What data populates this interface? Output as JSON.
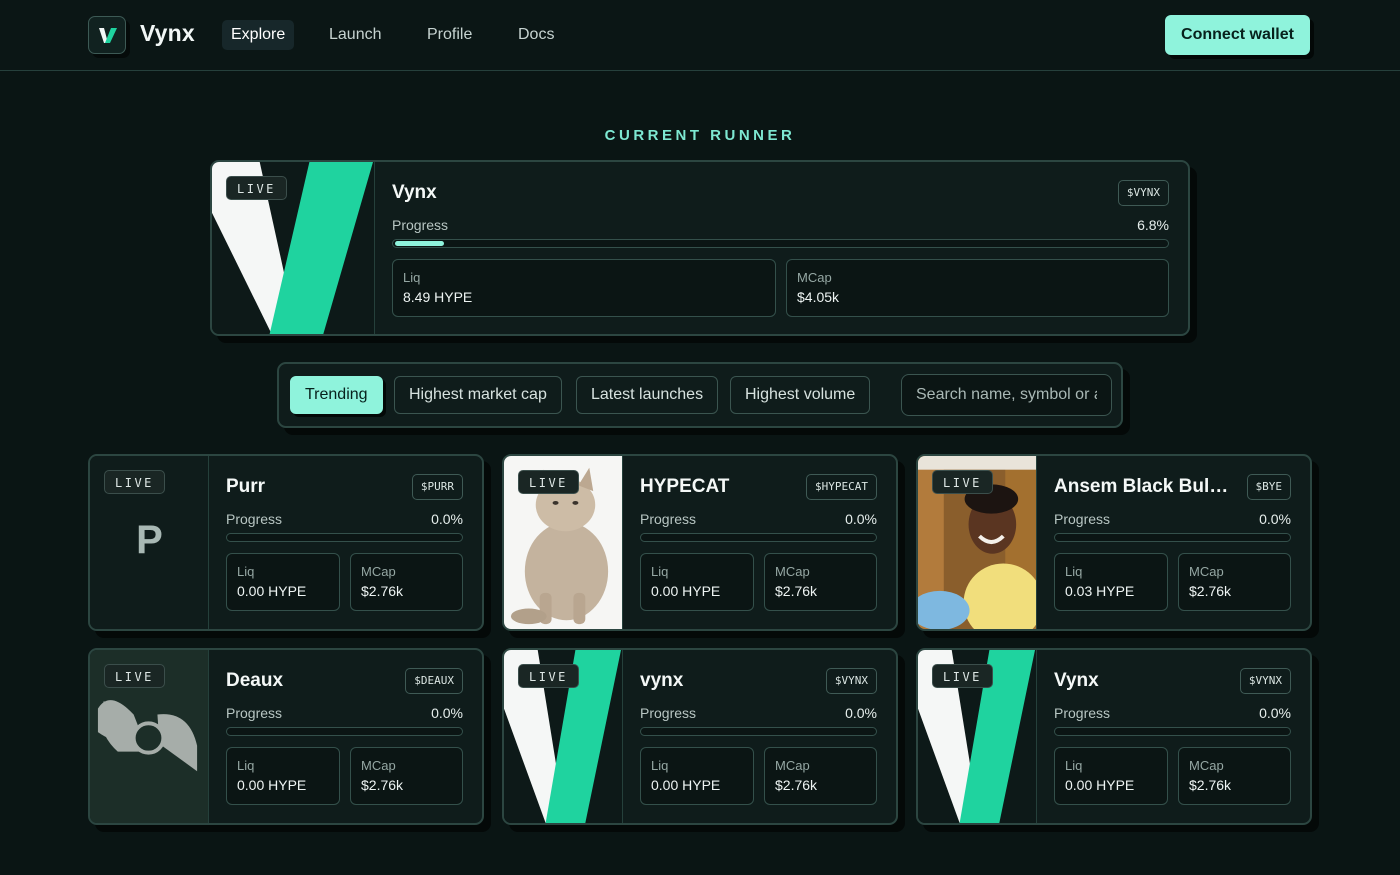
{
  "app": {
    "name": "Vynx",
    "logo_icon": "vynx-logo-icon"
  },
  "nav": {
    "items": [
      {
        "label": "Explore",
        "active": true
      },
      {
        "label": "Launch",
        "active": false
      },
      {
        "label": "Profile",
        "active": false
      },
      {
        "label": "Docs",
        "active": false
      }
    ]
  },
  "header": {
    "connect_label": "Connect wallet"
  },
  "runner": {
    "section_title": "CURRENT RUNNER",
    "live_label": "LIVE",
    "name": "Vynx",
    "symbol": "$VYNX",
    "progress_label": "Progress",
    "progress_value": "6.8%",
    "progress_fraction": 0.068,
    "liq_label": "Liq",
    "liq_value": "8.49 HYPE",
    "mcap_label": "MCap",
    "mcap_value": "$4.05k",
    "image": "vynx-logo"
  },
  "filters": {
    "tabs": [
      {
        "label": "Trending",
        "active": true
      },
      {
        "label": "Highest market cap",
        "active": false
      },
      {
        "label": "Latest launches",
        "active": false
      },
      {
        "label": "Highest volume",
        "active": false
      }
    ],
    "search_placeholder": "Search name, symbol or address"
  },
  "tokens": [
    {
      "name": "Purr",
      "symbol": "$PURR",
      "live_label": "LIVE",
      "progress_label": "Progress",
      "progress_value": "0.0%",
      "progress_fraction": 0.0,
      "liq_label": "Liq",
      "liq_value": "0.00 HYPE",
      "mcap_label": "MCap",
      "mcap_value": "$2.76k",
      "image": "letter-placeholder",
      "initial": "P"
    },
    {
      "name": "HYPECAT",
      "symbol": "$HYPECAT",
      "live_label": "LIVE",
      "progress_label": "Progress",
      "progress_value": "0.0%",
      "progress_fraction": 0.0,
      "liq_label": "Liq",
      "liq_value": "0.00 HYPE",
      "mcap_label": "MCap",
      "mcap_value": "$2.76k",
      "image": "cat-photo"
    },
    {
      "name": "Ansem Black Bull of Hyperliquid",
      "symbol": "$BYE",
      "live_label": "LIVE",
      "progress_label": "Progress",
      "progress_value": "0.0%",
      "progress_fraction": 0.0,
      "liq_label": "Liq",
      "liq_value": "0.03 HYPE",
      "mcap_label": "MCap",
      "mcap_value": "$2.76k",
      "image": "person-photo"
    },
    {
      "name": "Deaux",
      "symbol": "$DEAUX",
      "live_label": "LIVE",
      "progress_label": "Progress",
      "progress_value": "0.0%",
      "progress_fraction": 0.0,
      "liq_label": "Liq",
      "liq_value": "0.00 HYPE",
      "mcap_label": "MCap",
      "mcap_value": "$2.76k",
      "image": "abstract-logo"
    },
    {
      "name": "vynx",
      "symbol": "$VYNX",
      "live_label": "LIVE",
      "progress_label": "Progress",
      "progress_value": "0.0%",
      "progress_fraction": 0.0,
      "liq_label": "Liq",
      "liq_value": "0.00 HYPE",
      "mcap_label": "MCap",
      "mcap_value": "$2.76k",
      "image": "vynx-logo"
    },
    {
      "name": "Vynx",
      "symbol": "$VYNX",
      "live_label": "LIVE",
      "progress_label": "Progress",
      "progress_value": "0.0%",
      "progress_fraction": 0.0,
      "liq_label": "Liq",
      "liq_value": "0.00 HYPE",
      "mcap_label": "MCap",
      "mcap_value": "$2.76k",
      "image": "vynx-logo"
    }
  ],
  "colors": {
    "accent": "#8ff3dc",
    "brand_green": "#1fd39f",
    "background": "#0a1514",
    "card": "#0f1c1b"
  }
}
